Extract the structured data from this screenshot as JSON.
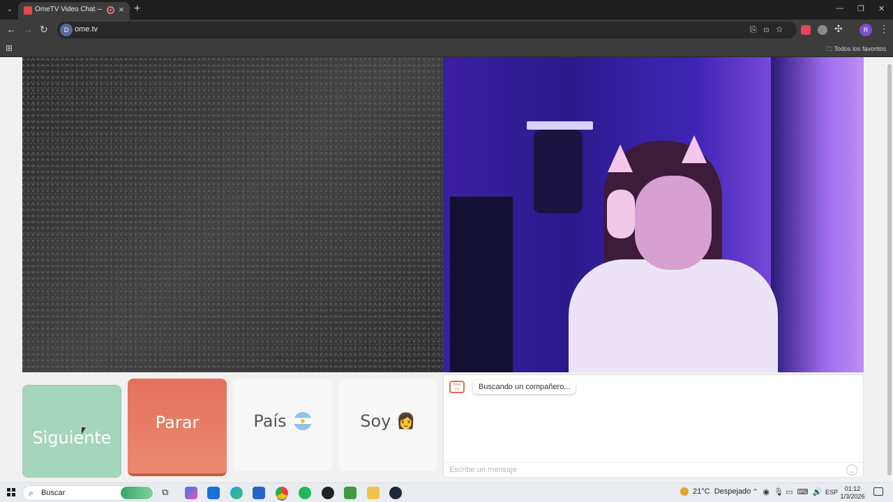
{
  "browser": {
    "tab_title": "OmeTV Video Chat — Ome",
    "url": "ome.tv",
    "bookmarks_folder": "Todos los favoritos",
    "profile_initial": "R",
    "site_icon_letter": "D"
  },
  "controls": {
    "next_label": "Siguiente",
    "stop_label": "Parar",
    "country_label": "País",
    "gender_label": "Soy",
    "gender_emoji": "👩"
  },
  "chat": {
    "logo_text": "Ome TV",
    "status_message": "Buscando un compañero...",
    "input_placeholder": "Escribe un mensaje"
  },
  "taskbar": {
    "search_label": "Buscar",
    "weather_temp": "21°C",
    "weather_text": "Despejado",
    "language": "ESP",
    "time": "01:12",
    "date": "1/3/2026"
  },
  "colors": {
    "next_button": "#a6d5bd",
    "stop_button": "#e5715b",
    "neutral_button": "#f7f7f7"
  }
}
